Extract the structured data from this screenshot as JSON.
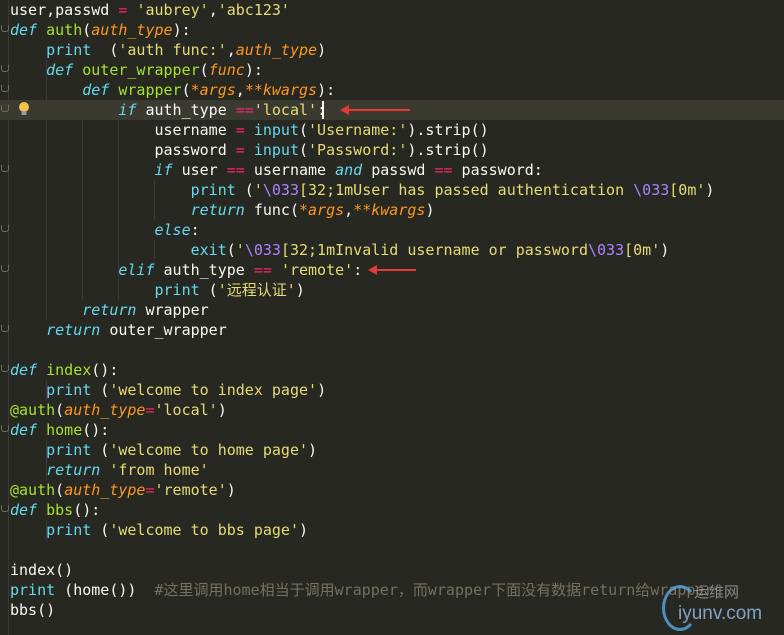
{
  "editor": {
    "highlighted_line": 5,
    "lines": [
      [
        [
          "tx",
          "user,passwd "
        ],
        [
          "op",
          "="
        ],
        [
          "tx",
          " "
        ],
        [
          "st",
          "'aubrey'"
        ],
        [
          "tx",
          ","
        ],
        [
          "st",
          "'abc123'"
        ]
      ],
      [
        [
          "kw",
          "def"
        ],
        [
          "tx",
          " "
        ],
        [
          "fn",
          "auth"
        ],
        [
          "tx",
          "("
        ],
        [
          "pa",
          "auth_type"
        ],
        [
          "tx",
          "):"
        ]
      ],
      [
        [
          "tx",
          "    "
        ],
        [
          "bi",
          "print"
        ],
        [
          "tx",
          "  ("
        ],
        [
          "st",
          "'auth func:'"
        ],
        [
          "tx",
          ","
        ],
        [
          "pa",
          "auth_type"
        ],
        [
          "tx",
          ")"
        ]
      ],
      [
        [
          "tx",
          "    "
        ],
        [
          "kw",
          "def"
        ],
        [
          "tx",
          " "
        ],
        [
          "fn",
          "outer_wrapper"
        ],
        [
          "tx",
          "("
        ],
        [
          "pa",
          "func"
        ],
        [
          "tx",
          "):"
        ]
      ],
      [
        [
          "tx",
          "        "
        ],
        [
          "kw",
          "def"
        ],
        [
          "tx",
          " "
        ],
        [
          "fn",
          "wrapper"
        ],
        [
          "tx",
          "("
        ],
        [
          "pa",
          "*args"
        ],
        [
          "tx",
          ","
        ],
        [
          "pa",
          "**kwargs"
        ],
        [
          "tx",
          "):"
        ]
      ],
      [
        [
          "tx",
          "            "
        ],
        [
          "kw",
          "if"
        ],
        [
          "tx",
          " auth_type "
        ],
        [
          "op",
          "=="
        ],
        [
          "st",
          "'local'"
        ],
        [
          "tx",
          ":"
        ]
      ],
      [
        [
          "tx",
          "                username "
        ],
        [
          "op",
          "="
        ],
        [
          "tx",
          " "
        ],
        [
          "bi",
          "input"
        ],
        [
          "tx",
          "("
        ],
        [
          "st",
          "'Username:'"
        ],
        [
          "tx",
          ").strip()"
        ]
      ],
      [
        [
          "tx",
          "                password "
        ],
        [
          "op",
          "="
        ],
        [
          "tx",
          " "
        ],
        [
          "bi",
          "input"
        ],
        [
          "tx",
          "("
        ],
        [
          "st",
          "'Password:'"
        ],
        [
          "tx",
          ").strip()"
        ]
      ],
      [
        [
          "tx",
          "                "
        ],
        [
          "kw",
          "if"
        ],
        [
          "tx",
          " user "
        ],
        [
          "op",
          "=="
        ],
        [
          "tx",
          " username "
        ],
        [
          "kw",
          "and"
        ],
        [
          "tx",
          " passwd "
        ],
        [
          "op",
          "=="
        ],
        [
          "tx",
          " password:"
        ]
      ],
      [
        [
          "tx",
          "                    "
        ],
        [
          "bi",
          "print"
        ],
        [
          "tx",
          " ("
        ],
        [
          "st",
          "'"
        ],
        [
          "es",
          "\\033"
        ],
        [
          "st",
          "[32;1mUser has passed authentication "
        ],
        [
          "es",
          "\\033"
        ],
        [
          "st",
          "[0m'"
        ],
        [
          "tx",
          ")"
        ]
      ],
      [
        [
          "tx",
          "                    "
        ],
        [
          "kw",
          "return"
        ],
        [
          "tx",
          " func("
        ],
        [
          "pa",
          "*args"
        ],
        [
          "tx",
          ","
        ],
        [
          "pa",
          "**kwargs"
        ],
        [
          "tx",
          ")"
        ]
      ],
      [
        [
          "tx",
          "                "
        ],
        [
          "kw",
          "else"
        ],
        [
          "tx",
          ":"
        ]
      ],
      [
        [
          "tx",
          "                    "
        ],
        [
          "bi",
          "exit"
        ],
        [
          "tx",
          "("
        ],
        [
          "st",
          "'"
        ],
        [
          "es",
          "\\033"
        ],
        [
          "st",
          "[32;1mInvalid username or password"
        ],
        [
          "es",
          "\\033"
        ],
        [
          "st",
          "[0m'"
        ],
        [
          "tx",
          ")"
        ]
      ],
      [
        [
          "tx",
          "            "
        ],
        [
          "kw",
          "elif"
        ],
        [
          "tx",
          " auth_type "
        ],
        [
          "op",
          "=="
        ],
        [
          "tx",
          " "
        ],
        [
          "st",
          "'remote'"
        ],
        [
          "tx",
          ":"
        ]
      ],
      [
        [
          "tx",
          "                "
        ],
        [
          "bi",
          "print"
        ],
        [
          "tx",
          " ("
        ],
        [
          "st",
          "'远程认证'"
        ],
        [
          "tx",
          ")"
        ]
      ],
      [
        [
          "tx",
          "        "
        ],
        [
          "kw",
          "return"
        ],
        [
          "tx",
          " wrapper"
        ]
      ],
      [
        [
          "tx",
          "    "
        ],
        [
          "kw",
          "return"
        ],
        [
          "tx",
          " outer_wrapper"
        ]
      ],
      [],
      [
        [
          "kw",
          "def"
        ],
        [
          "tx",
          " "
        ],
        [
          "fn",
          "index"
        ],
        [
          "tx",
          "():"
        ]
      ],
      [
        [
          "tx",
          "    "
        ],
        [
          "bi",
          "print"
        ],
        [
          "tx",
          " ("
        ],
        [
          "st",
          "'welcome to index page'"
        ],
        [
          "tx",
          ")"
        ]
      ],
      [
        [
          "fn",
          "@auth"
        ],
        [
          "tx",
          "("
        ],
        [
          "pa",
          "auth_type"
        ],
        [
          "op",
          "="
        ],
        [
          "st",
          "'local'"
        ],
        [
          "tx",
          ")"
        ]
      ],
      [
        [
          "kw",
          "def"
        ],
        [
          "tx",
          " "
        ],
        [
          "fn",
          "home"
        ],
        [
          "tx",
          "():"
        ]
      ],
      [
        [
          "tx",
          "    "
        ],
        [
          "bi",
          "print"
        ],
        [
          "tx",
          " ("
        ],
        [
          "st",
          "'welcome to home page'"
        ],
        [
          "tx",
          ")"
        ]
      ],
      [
        [
          "tx",
          "    "
        ],
        [
          "kw",
          "return"
        ],
        [
          "tx",
          " "
        ],
        [
          "st",
          "'from home'"
        ]
      ],
      [
        [
          "fn",
          "@auth"
        ],
        [
          "tx",
          "("
        ],
        [
          "pa",
          "auth_type"
        ],
        [
          "op",
          "="
        ],
        [
          "st",
          "'remote'"
        ],
        [
          "tx",
          ")"
        ]
      ],
      [
        [
          "kw",
          "def"
        ],
        [
          "tx",
          " "
        ],
        [
          "fn",
          "bbs"
        ],
        [
          "tx",
          "():"
        ]
      ],
      [
        [
          "tx",
          "    "
        ],
        [
          "bi",
          "print"
        ],
        [
          "tx",
          " ("
        ],
        [
          "st",
          "'welcome to bbs page'"
        ],
        [
          "tx",
          ")"
        ]
      ],
      [],
      [
        [
          "tx",
          "index()"
        ]
      ],
      [
        [
          "bi",
          "print"
        ],
        [
          "tx",
          " (home())  "
        ],
        [
          "cm",
          "#这里调用home相当于调用wrapper，而wrapper下面没有数据return给wrapper"
        ]
      ],
      [
        [
          "tx",
          "bbs()"
        ]
      ]
    ]
  },
  "watermark": {
    "line1": "运维网",
    "line2": "iyunv.com"
  },
  "colors": {
    "background": "#272822",
    "arrow": "#e53935",
    "keyword": "#66d9ef",
    "string": "#e6db74",
    "function": "#a6e22e",
    "param": "#fd971f"
  }
}
